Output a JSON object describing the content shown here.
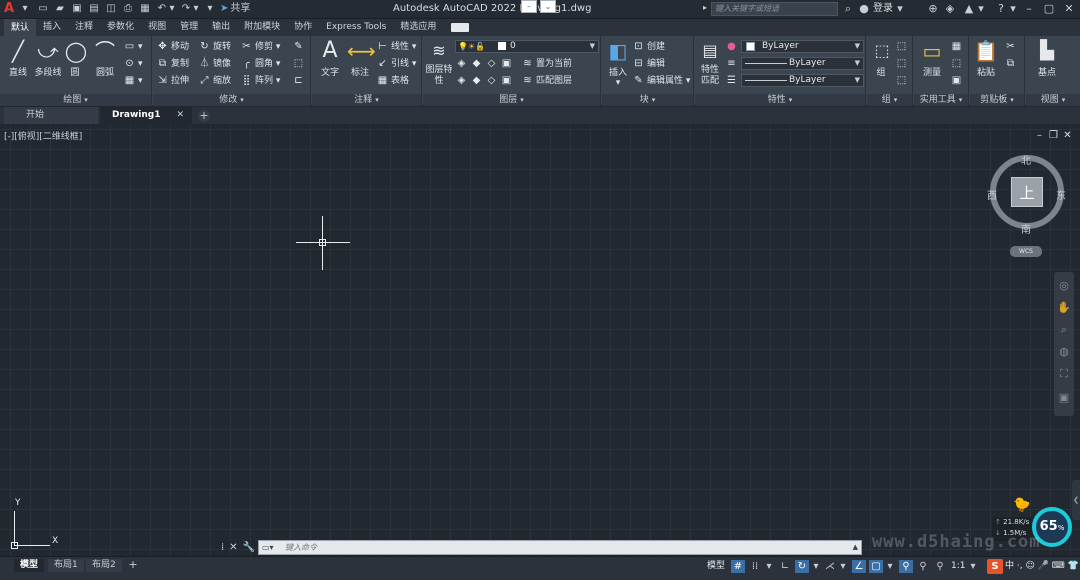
{
  "title_bar": {
    "app_logo": "A",
    "window_title": "Autodesk AutoCAD 2022   Drawing1.dwg",
    "share_label": "共享",
    "search_placeholder": "键入关键字或短语",
    "login_label": "登录",
    "help_label": "?"
  },
  "ribbon_tabs": [
    "默认",
    "插入",
    "注释",
    "参数化",
    "视图",
    "管理",
    "输出",
    "附加模块",
    "协作",
    "Express Tools",
    "精选应用"
  ],
  "ribbon": {
    "draw": {
      "title": "绘图",
      "line": "直线",
      "polyline": "多段线",
      "circle": "圆",
      "arc": "圆弧"
    },
    "modify": {
      "title": "修改",
      "move": "移动",
      "rotate": "旋转",
      "trim": "修剪",
      "copy": "复制",
      "mirror": "镜像",
      "fillet": "圆角",
      "stretch": "拉伸",
      "scale": "缩放",
      "array": "阵列"
    },
    "annotation": {
      "title": "注释",
      "text": "文字",
      "dimension": "标注",
      "linear": "线性",
      "leader": "引线",
      "table": "表格"
    },
    "layers": {
      "title": "图层",
      "layer_properties": "图层特性",
      "current_layer": "0",
      "set_current": "置为当前",
      "match_layer": "匹配图层"
    },
    "block": {
      "title": "块",
      "insert": "插入",
      "create": "创建",
      "edit": "编辑",
      "edit_attributes": "编辑属性"
    },
    "properties": {
      "title": "特性",
      "match_properties": "特性匹配",
      "color": "ByLayer",
      "linetype": "ByLayer",
      "lineweight": "ByLayer"
    },
    "groups": {
      "title": "组",
      "group": "组"
    },
    "utilities": {
      "title": "实用工具",
      "measure": "测量"
    },
    "clipboard": {
      "title": "剪贴板",
      "paste": "粘贴"
    },
    "view": {
      "title": "视图",
      "base": "基点"
    }
  },
  "file_tabs": {
    "start": "开始",
    "drawing": "Drawing1"
  },
  "viewport": {
    "label": "[-][俯视][二维线框]",
    "viewcube_face": "上",
    "north": "北",
    "south": "南",
    "east": "东",
    "west": "西",
    "wcs": "WCS",
    "ucs_x": "X",
    "ucs_y": "Y"
  },
  "command_line": {
    "placeholder": "键入命令"
  },
  "perf_widget": {
    "upload": "21.8",
    "upload_unit": "K/s",
    "download": "1.5",
    "download_unit": "M/s",
    "percent": "65",
    "percent_unit": "%"
  },
  "layout_tabs": [
    "模型",
    "布局1",
    "布局2"
  ],
  "status_bar": {
    "model_label": "模型",
    "scale": "1:1",
    "ime_logo": "S",
    "ime_tools": "中 ·, ☺ 🎤 ⌨ 👕 ⚏"
  },
  "watermark": "www.d5haing.com"
}
